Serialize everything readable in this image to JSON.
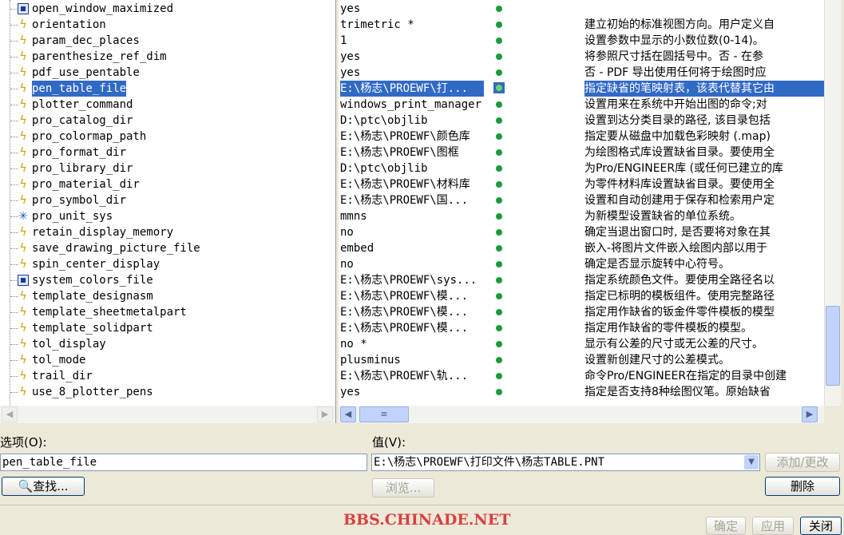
{
  "options": [
    {
      "name": "open_window_maximized",
      "icon": "box-icon",
      "value": "yes",
      "desc": "",
      "selected": false
    },
    {
      "name": "orientation",
      "icon": "lightning-icon",
      "value": "trimetric *",
      "desc": "建立初始的标准视图方向。用户定义自",
      "selected": false
    },
    {
      "name": "param_dec_places",
      "icon": "lightning-icon",
      "value": "1",
      "desc": "设置参数中显示的小数位数(0-14)。",
      "selected": false
    },
    {
      "name": "parenthesize_ref_dim",
      "icon": "lightning-icon",
      "value": "yes",
      "desc": "将参照尺寸括在圆括号中。否 - 在参",
      "selected": false
    },
    {
      "name": "pdf_use_pentable",
      "icon": "lightning-icon",
      "value": "yes",
      "desc": "否 - PDF 导出使用任何将于绘图时应",
      "selected": false
    },
    {
      "name": "pen_table_file",
      "icon": "lightning-icon",
      "value": "E:\\杨志\\PROEWF\\打...",
      "desc": "指定缺省的笔映射表，该表代替其它由",
      "selected": true
    },
    {
      "name": "plotter_command",
      "icon": "lightning-icon",
      "value": "windows_print_manager",
      "desc": "设置用来在系统中开始出图的命令;对",
      "selected": false
    },
    {
      "name": "pro_catalog_dir",
      "icon": "lightning-icon",
      "value": "D:\\ptc\\objlib",
      "desc": "设置到达分类目录的路径, 该目录包括",
      "selected": false
    },
    {
      "name": "pro_colormap_path",
      "icon": "lightning-icon",
      "value": "E:\\杨志\\PROEWF\\颜色库",
      "desc": "指定要从磁盘中加载色彩映射 (.map)",
      "selected": false
    },
    {
      "name": "pro_format_dir",
      "icon": "lightning-icon",
      "value": "E:\\杨志\\PROEWF\\图框",
      "desc": "为绘图格式库设置缺省目录。要使用全",
      "selected": false
    },
    {
      "name": "pro_library_dir",
      "icon": "lightning-icon",
      "value": "D:\\ptc\\objlib",
      "desc": "为Pro/ENGINEER库 (或任何已建立的库",
      "selected": false
    },
    {
      "name": "pro_material_dir",
      "icon": "lightning-icon",
      "value": "E:\\杨志\\PROEWF\\材料库",
      "desc": "为零件材料库设置缺省目录。要使用全",
      "selected": false
    },
    {
      "name": "pro_symbol_dir",
      "icon": "lightning-icon",
      "value": "E:\\杨志\\PROEWF\\国...",
      "desc": "设置和自动创建用于保存和检索用户定",
      "selected": false
    },
    {
      "name": "pro_unit_sys",
      "icon": "star-icon",
      "value": "mmns",
      "desc": "为新模型设置缺省的单位系统。",
      "selected": false
    },
    {
      "name": "retain_display_memory",
      "icon": "lightning-icon",
      "value": "no",
      "desc": "确定当退出窗口时, 是否要将对象在其",
      "selected": false
    },
    {
      "name": "save_drawing_picture_file",
      "icon": "lightning-icon",
      "value": "embed",
      "desc": "嵌入-将图片文件嵌入绘图内部以用于",
      "selected": false
    },
    {
      "name": "spin_center_display",
      "icon": "lightning-icon",
      "value": "no",
      "desc": "确定是否显示旋转中心符号。",
      "selected": false
    },
    {
      "name": "system_colors_file",
      "icon": "box-icon",
      "value": "E:\\杨志\\PROEWF\\sys...",
      "desc": "指定系统颜色文件。要使用全路径名以",
      "selected": false
    },
    {
      "name": "template_designasm",
      "icon": "lightning-icon",
      "value": "E:\\杨志\\PROEWF\\模...",
      "desc": "指定已标明的模板组件。使用完整路径",
      "selected": false
    },
    {
      "name": "template_sheetmetalpart",
      "icon": "lightning-icon",
      "value": "E:\\杨志\\PROEWF\\模...",
      "desc": "指定用作缺省的钣金件零件模板的模型",
      "selected": false
    },
    {
      "name": "template_solidpart",
      "icon": "lightning-icon",
      "value": "E:\\杨志\\PROEWF\\模...",
      "desc": "指定用作缺省的零件模板的模型。",
      "selected": false
    },
    {
      "name": "tol_display",
      "icon": "lightning-icon",
      "value": "no *",
      "desc": "显示有公差的尺寸或无公差的尺寸。",
      "selected": false
    },
    {
      "name": "tol_mode",
      "icon": "lightning-icon",
      "value": "plusminus",
      "desc": "设置新创建尺寸的公差模式。",
      "selected": false
    },
    {
      "name": "trail_dir",
      "icon": "lightning-icon",
      "value": "E:\\杨志\\PROEWF\\轨...",
      "desc": "命令Pro/ENGINEER在指定的目录中创建",
      "selected": false
    },
    {
      "name": "use_8_plotter_pens",
      "icon": "lightning-icon",
      "value": "yes",
      "desc": "指定是否支持8种绘图仪笔。原始缺省",
      "selected": false
    }
  ],
  "form": {
    "option_label": "选项(O):",
    "option_value": "pen_table_file",
    "value_label": "值(V):",
    "value_value": "E:\\杨志\\PROEWF\\打印文件\\杨志TABLE.PNT",
    "find_button": "查找...",
    "browse_button": "浏览...",
    "add_change_button": "添加/更改",
    "delete_button": "删除"
  },
  "footer": {
    "ok_button": "确定",
    "apply_button": "应用",
    "close_button": "关闭"
  },
  "watermark": "BBS.CHINADE.NET",
  "colors": {
    "selection": "#316ac5",
    "status_dot": "#1d9a3a",
    "watermark": "#d94040"
  }
}
